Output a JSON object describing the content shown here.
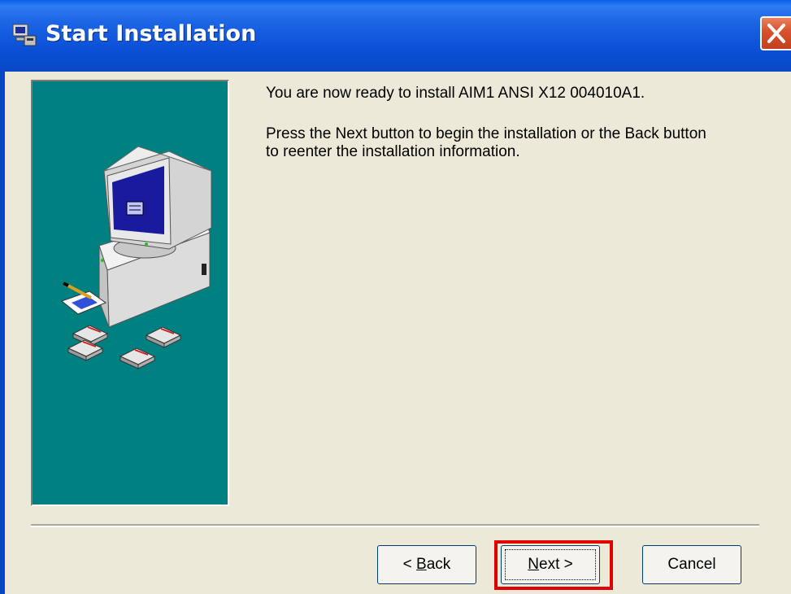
{
  "window": {
    "title": "Start Installation",
    "icon": "installer-icon",
    "close_icon": "close-icon"
  },
  "content": {
    "ready_text": "You are now ready to install AIM1 ANSI X12 004010A1.",
    "instructions": "Press the Next button to begin the installation or the Back button to reenter the installation information."
  },
  "buttons": {
    "back_mnemonic": "B",
    "back_rest": "ack",
    "back_prefix": "< ",
    "next_mnemonic": "N",
    "next_rest": "ext >",
    "cancel": "Cancel"
  },
  "colors": {
    "titlebar": "#0848C8",
    "panel": "#008080",
    "highlight": "#E00000",
    "dialog_bg": "#ECE9D8"
  }
}
